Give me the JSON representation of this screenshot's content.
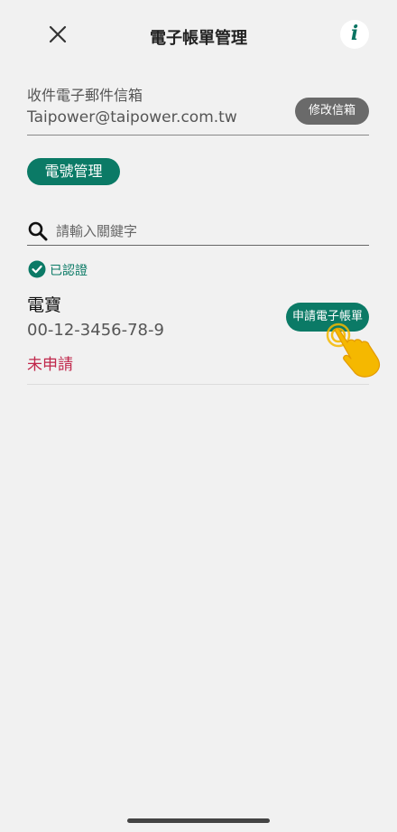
{
  "header": {
    "title": "電子帳單管理",
    "info_label": "i"
  },
  "email": {
    "label": "收件電子郵件信箱",
    "value": "Taipower@taipower.com.tw",
    "edit_label": "修改信箱"
  },
  "account_management_label": "電號管理",
  "search": {
    "placeholder": "請輸入關鍵字"
  },
  "verified_label": "已認證",
  "accounts": [
    {
      "name": "電寶",
      "number": "00-12-3456-78-9",
      "status": "未申請",
      "apply_label": "申請電子帳單"
    }
  ],
  "colors": {
    "accent": "#0b7a66",
    "status_unapplied": "#c0264a",
    "edit_button": "#6a6a6a",
    "hand_pointer": "#f5b800"
  },
  "icons": [
    "close-icon",
    "info-icon",
    "search-icon",
    "verified-check-icon",
    "tap-hand-icon"
  ]
}
